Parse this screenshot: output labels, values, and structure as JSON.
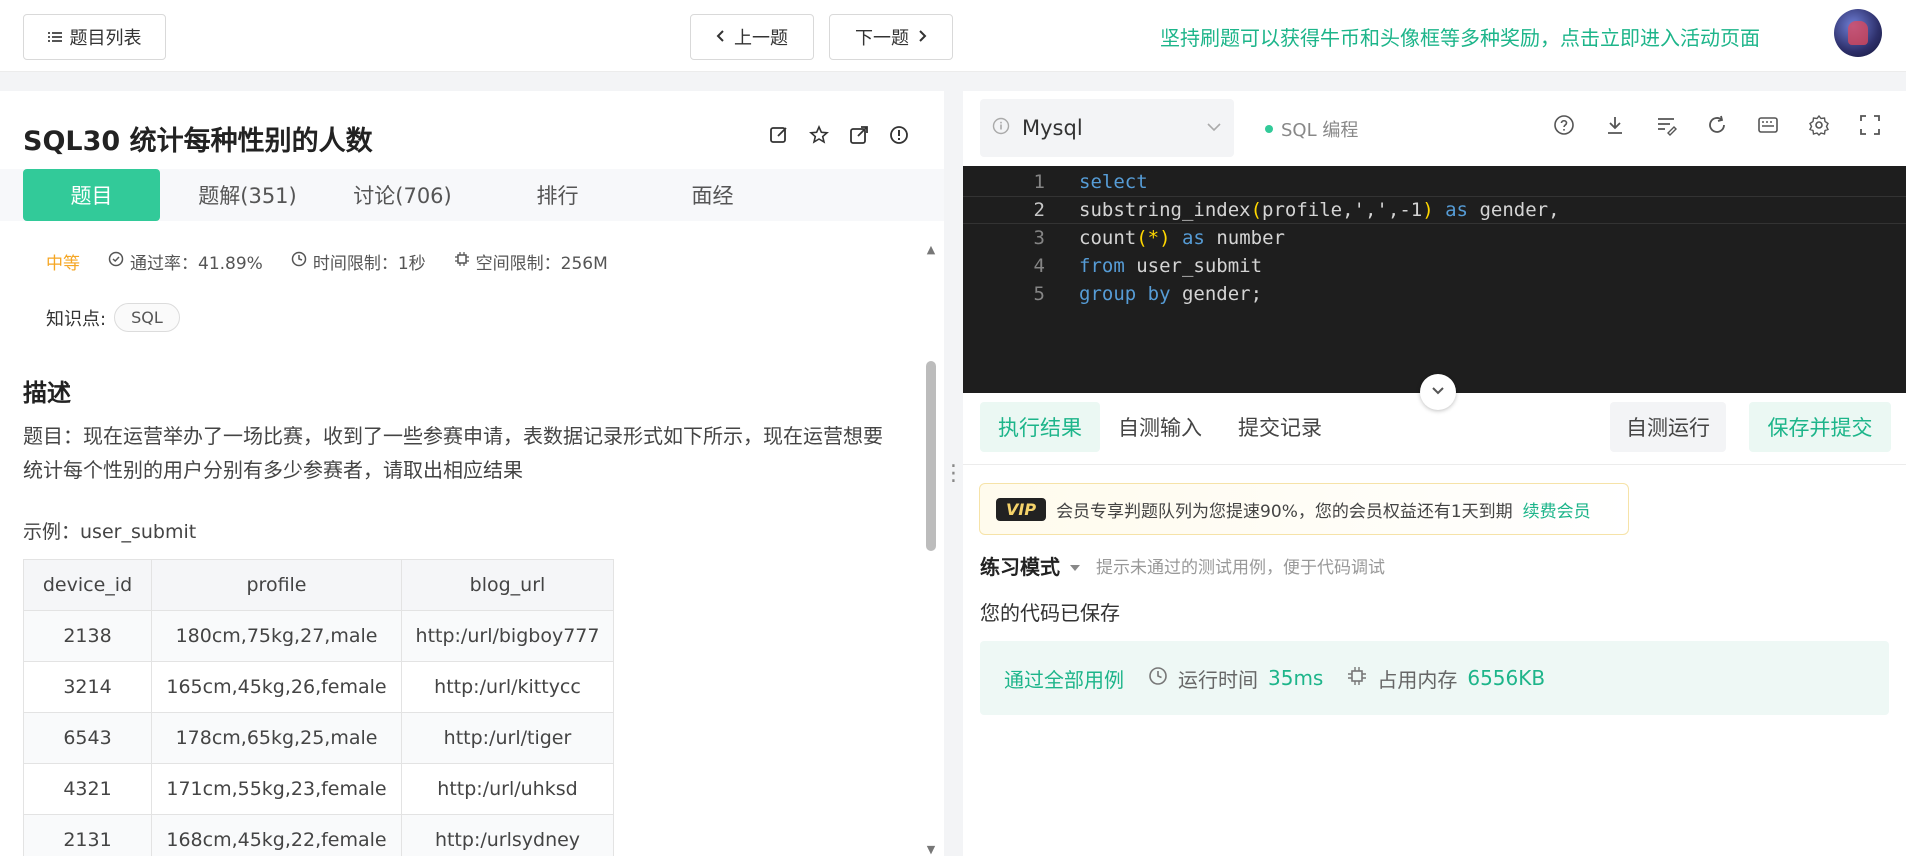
{
  "topbar": {
    "list_label": "题目列表",
    "prev_label": "上一题",
    "next_label": "下一题",
    "promo": "坚持刷题可以获得牛币和头像框等多种奖励，点击立即进入活动页面"
  },
  "problem": {
    "title": "SQL30  统计每种性别的人数",
    "tabs": [
      "题目",
      "题解(351)",
      "讨论(706)",
      "排行",
      "面经"
    ],
    "difficulty": "中等",
    "pass_rate": "通过率：41.89%",
    "time_limit": "时间限制：1秒",
    "space_limit": "空间限制：256M",
    "knowledge_label": "知识点:",
    "knowledge_tag": "SQL",
    "section_title": "描述",
    "description": "题目：现在运营举办了一场比赛，收到了一些参赛申请，表数据记录形式如下所示，现在运营想要统计每个性别的用户分别有多少参赛者，请取出相应结果",
    "example_label": "示例：user_submit",
    "table": {
      "headers": [
        "device_id",
        "profile",
        "blog_url"
      ],
      "rows": [
        [
          "2138",
          "180cm,75kg,27,male",
          "http:/url/bigboy777"
        ],
        [
          "3214",
          "165cm,45kg,26,female",
          "http:/url/kittycc"
        ],
        [
          "6543",
          "178cm,65kg,25,male",
          "http:/url/tiger"
        ],
        [
          "4321",
          "171cm,55kg,23,female",
          "http:/url/uhksd"
        ],
        [
          "2131",
          "168cm,45kg,22,female",
          "http:/urlsydney"
        ]
      ]
    }
  },
  "editor": {
    "language": "Mysql",
    "mode": "SQL 编程",
    "line_numbers": [
      "1",
      "2",
      "3",
      "4",
      "5"
    ]
  },
  "results": {
    "tabs": [
      "执行结果",
      "自测输入",
      "提交记录"
    ],
    "run_label": "自测运行",
    "submit_label": "保存并提交",
    "vip_badge": "VIP",
    "vip_text": "会员专享判题队列为您提速90%，您的会员权益还有1天到期",
    "vip_link": "续费会员",
    "practice_label": "练习模式",
    "practice_hint": "提示未通过的测试用例，便于代码调试",
    "saved": "您的代码已保存",
    "pass_all": "通过全部用例",
    "runtime_label": "运行时间",
    "runtime_value": "35ms",
    "memory_label": "占用内存",
    "memory_value": "6556KB"
  },
  "colors": {
    "accent": "#32ca99",
    "accent_text": "#1db58a",
    "difficulty": "#f5a623",
    "editor_bg": "#1e1e1e"
  }
}
